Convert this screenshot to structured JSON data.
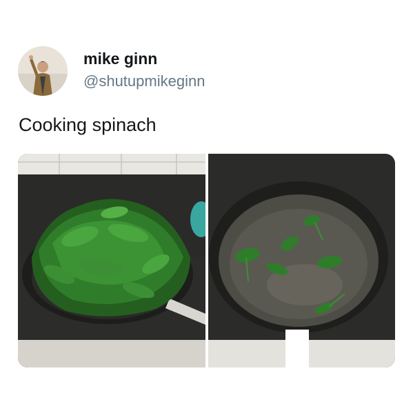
{
  "tweet": {
    "author_name": "mike ginn",
    "author_handle": "@shutupmikeginn",
    "text": "Cooking spinach"
  },
  "media": {
    "photos": [
      {
        "subject": "pan-full-of-raw-spinach"
      },
      {
        "subject": "pan-with-wilted-spinach"
      }
    ]
  },
  "colors": {
    "name": "#14171a",
    "handle": "#657786",
    "spinach": "#2f7d2a"
  }
}
